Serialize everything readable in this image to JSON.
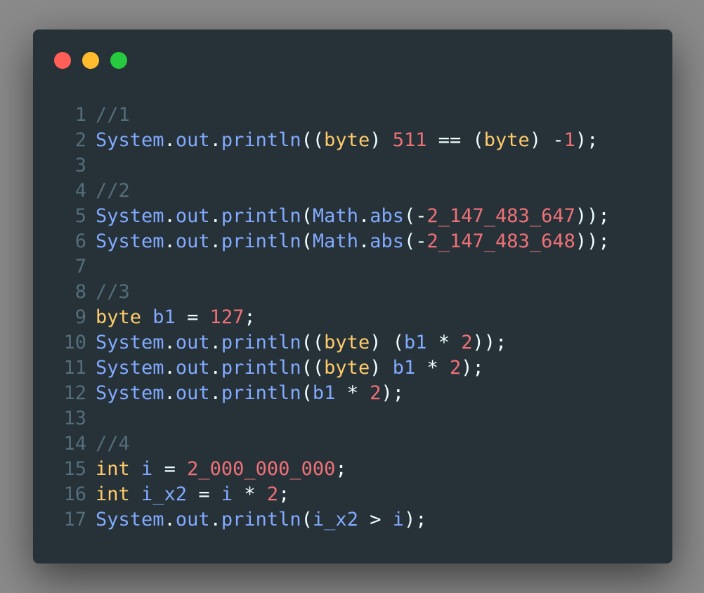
{
  "colors": {
    "background": "#8a8a8a",
    "window": "#263238",
    "comment": "#546e7a",
    "function": "#82aaff",
    "keyword": "#ffcb6b",
    "number": "#f07178",
    "plain": "#eeffff"
  },
  "window_controls": [
    {
      "name": "close",
      "color": "#ff5f56"
    },
    {
      "name": "minimize",
      "color": "#ffbd2e"
    },
    {
      "name": "maximize",
      "color": "#27c93f"
    }
  ],
  "code_lines": [
    {
      "number": "1",
      "tokens": [
        {
          "t": "//1",
          "c": "c"
        }
      ]
    },
    {
      "number": "2",
      "tokens": [
        {
          "t": "System",
          "c": "f"
        },
        {
          "t": ".",
          "c": "p"
        },
        {
          "t": "out",
          "c": "f"
        },
        {
          "t": ".",
          "c": "p"
        },
        {
          "t": "println",
          "c": "f"
        },
        {
          "t": "((",
          "c": "p"
        },
        {
          "t": "byte",
          "c": "k"
        },
        {
          "t": ") ",
          "c": "p"
        },
        {
          "t": "511",
          "c": "n"
        },
        {
          "t": " == (",
          "c": "p"
        },
        {
          "t": "byte",
          "c": "k"
        },
        {
          "t": ") -",
          "c": "p"
        },
        {
          "t": "1",
          "c": "n"
        },
        {
          "t": ");",
          "c": "p"
        }
      ]
    },
    {
      "number": "3",
      "tokens": []
    },
    {
      "number": "4",
      "tokens": [
        {
          "t": "//2",
          "c": "c"
        }
      ]
    },
    {
      "number": "5",
      "tokens": [
        {
          "t": "System",
          "c": "f"
        },
        {
          "t": ".",
          "c": "p"
        },
        {
          "t": "out",
          "c": "f"
        },
        {
          "t": ".",
          "c": "p"
        },
        {
          "t": "println",
          "c": "f"
        },
        {
          "t": "(",
          "c": "p"
        },
        {
          "t": "Math",
          "c": "f"
        },
        {
          "t": ".",
          "c": "p"
        },
        {
          "t": "abs",
          "c": "f"
        },
        {
          "t": "(-",
          "c": "p"
        },
        {
          "t": "2_147_483_647",
          "c": "n"
        },
        {
          "t": "));",
          "c": "p"
        }
      ]
    },
    {
      "number": "6",
      "tokens": [
        {
          "t": "System",
          "c": "f"
        },
        {
          "t": ".",
          "c": "p"
        },
        {
          "t": "out",
          "c": "f"
        },
        {
          "t": ".",
          "c": "p"
        },
        {
          "t": "println",
          "c": "f"
        },
        {
          "t": "(",
          "c": "p"
        },
        {
          "t": "Math",
          "c": "f"
        },
        {
          "t": ".",
          "c": "p"
        },
        {
          "t": "abs",
          "c": "f"
        },
        {
          "t": "(-",
          "c": "p"
        },
        {
          "t": "2_147_483_648",
          "c": "n"
        },
        {
          "t": "));",
          "c": "p"
        }
      ]
    },
    {
      "number": "7",
      "tokens": []
    },
    {
      "number": "8",
      "tokens": [
        {
          "t": "//3",
          "c": "c"
        }
      ]
    },
    {
      "number": "9",
      "tokens": [
        {
          "t": "byte",
          "c": "k"
        },
        {
          "t": " ",
          "c": "p"
        },
        {
          "t": "b1",
          "c": "f"
        },
        {
          "t": " = ",
          "c": "p"
        },
        {
          "t": "127",
          "c": "n"
        },
        {
          "t": ";",
          "c": "p"
        }
      ]
    },
    {
      "number": "10",
      "tokens": [
        {
          "t": "System",
          "c": "f"
        },
        {
          "t": ".",
          "c": "p"
        },
        {
          "t": "out",
          "c": "f"
        },
        {
          "t": ".",
          "c": "p"
        },
        {
          "t": "println",
          "c": "f"
        },
        {
          "t": "((",
          "c": "p"
        },
        {
          "t": "byte",
          "c": "k"
        },
        {
          "t": ") (",
          "c": "p"
        },
        {
          "t": "b1",
          "c": "f"
        },
        {
          "t": " * ",
          "c": "p"
        },
        {
          "t": "2",
          "c": "n"
        },
        {
          "t": "));",
          "c": "p"
        }
      ]
    },
    {
      "number": "11",
      "tokens": [
        {
          "t": "System",
          "c": "f"
        },
        {
          "t": ".",
          "c": "p"
        },
        {
          "t": "out",
          "c": "f"
        },
        {
          "t": ".",
          "c": "p"
        },
        {
          "t": "println",
          "c": "f"
        },
        {
          "t": "((",
          "c": "p"
        },
        {
          "t": "byte",
          "c": "k"
        },
        {
          "t": ") ",
          "c": "p"
        },
        {
          "t": "b1",
          "c": "f"
        },
        {
          "t": " * ",
          "c": "p"
        },
        {
          "t": "2",
          "c": "n"
        },
        {
          "t": ");",
          "c": "p"
        }
      ]
    },
    {
      "number": "12",
      "tokens": [
        {
          "t": "System",
          "c": "f"
        },
        {
          "t": ".",
          "c": "p"
        },
        {
          "t": "out",
          "c": "f"
        },
        {
          "t": ".",
          "c": "p"
        },
        {
          "t": "println",
          "c": "f"
        },
        {
          "t": "(",
          "c": "p"
        },
        {
          "t": "b1",
          "c": "f"
        },
        {
          "t": " * ",
          "c": "p"
        },
        {
          "t": "2",
          "c": "n"
        },
        {
          "t": ");",
          "c": "p"
        }
      ]
    },
    {
      "number": "13",
      "tokens": []
    },
    {
      "number": "14",
      "tokens": [
        {
          "t": "//4",
          "c": "c"
        }
      ]
    },
    {
      "number": "15",
      "tokens": [
        {
          "t": "int",
          "c": "k"
        },
        {
          "t": " ",
          "c": "p"
        },
        {
          "t": "i",
          "c": "f"
        },
        {
          "t": " = ",
          "c": "p"
        },
        {
          "t": "2_000_000_000",
          "c": "n"
        },
        {
          "t": ";",
          "c": "p"
        }
      ]
    },
    {
      "number": "16",
      "tokens": [
        {
          "t": "int",
          "c": "k"
        },
        {
          "t": " ",
          "c": "p"
        },
        {
          "t": "i_x2",
          "c": "f"
        },
        {
          "t": " = ",
          "c": "p"
        },
        {
          "t": "i",
          "c": "f"
        },
        {
          "t": " * ",
          "c": "p"
        },
        {
          "t": "2",
          "c": "n"
        },
        {
          "t": ";",
          "c": "p"
        }
      ]
    },
    {
      "number": "17",
      "tokens": [
        {
          "t": "System",
          "c": "f"
        },
        {
          "t": ".",
          "c": "p"
        },
        {
          "t": "out",
          "c": "f"
        },
        {
          "t": ".",
          "c": "p"
        },
        {
          "t": "println",
          "c": "f"
        },
        {
          "t": "(",
          "c": "p"
        },
        {
          "t": "i_x2",
          "c": "f"
        },
        {
          "t": " > ",
          "c": "p"
        },
        {
          "t": "i",
          "c": "f"
        },
        {
          "t": ");",
          "c": "p"
        }
      ]
    }
  ]
}
